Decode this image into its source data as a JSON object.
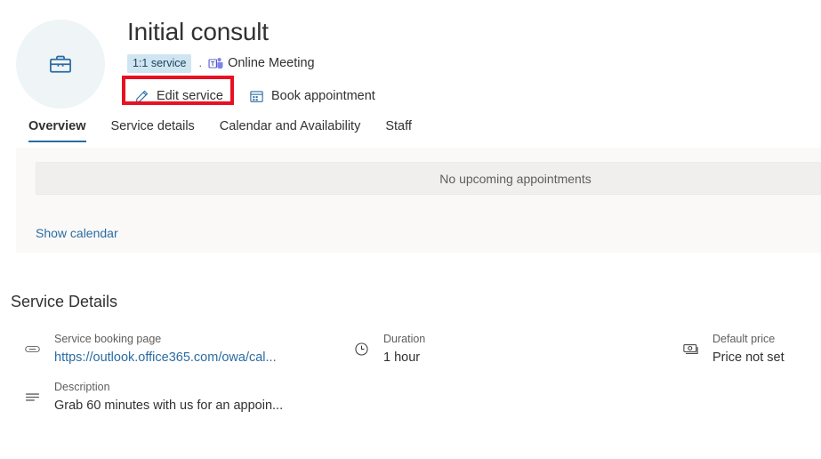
{
  "header": {
    "avatar_icon": "briefcase-icon",
    "title": "Initial consult",
    "badge": "1:1 service",
    "separator": ".",
    "meeting_icon": "teams-icon",
    "meeting_type": "Online Meeting",
    "actions": [
      {
        "icon": "pencil-icon",
        "label": "Edit service"
      },
      {
        "icon": "calendar-icon",
        "label": "Book appointment"
      }
    ],
    "highlight_color": "#e81123"
  },
  "tabs": [
    {
      "label": "Overview",
      "active": true
    },
    {
      "label": "Service details",
      "active": false
    },
    {
      "label": "Calendar and Availability",
      "active": false
    },
    {
      "label": "Staff",
      "active": false
    }
  ],
  "appointments_panel": {
    "empty_message": "No upcoming appointments",
    "show_calendar_link": "Show calendar"
  },
  "service_details": {
    "heading": "Service Details",
    "items": [
      {
        "icon": "link-icon",
        "label": "Service booking page",
        "value": "https://outlook.office365.com/owa/cal...",
        "is_link": true
      },
      {
        "icon": "description-lines-icon",
        "label": "Description",
        "value": "Grab 60 minutes with us for an appoin...",
        "is_link": false
      },
      {
        "icon": "clock-icon",
        "label": "Duration",
        "value": "1 hour",
        "is_link": false
      },
      {
        "icon": "money-icon",
        "label": "Default price",
        "value": "Price not set",
        "is_link": false
      }
    ]
  },
  "colors": {
    "accent": "#2b6ca3",
    "badge_bg": "#cfe6f2",
    "panel_bg": "#faf9f8",
    "highlight": "#e81123"
  }
}
